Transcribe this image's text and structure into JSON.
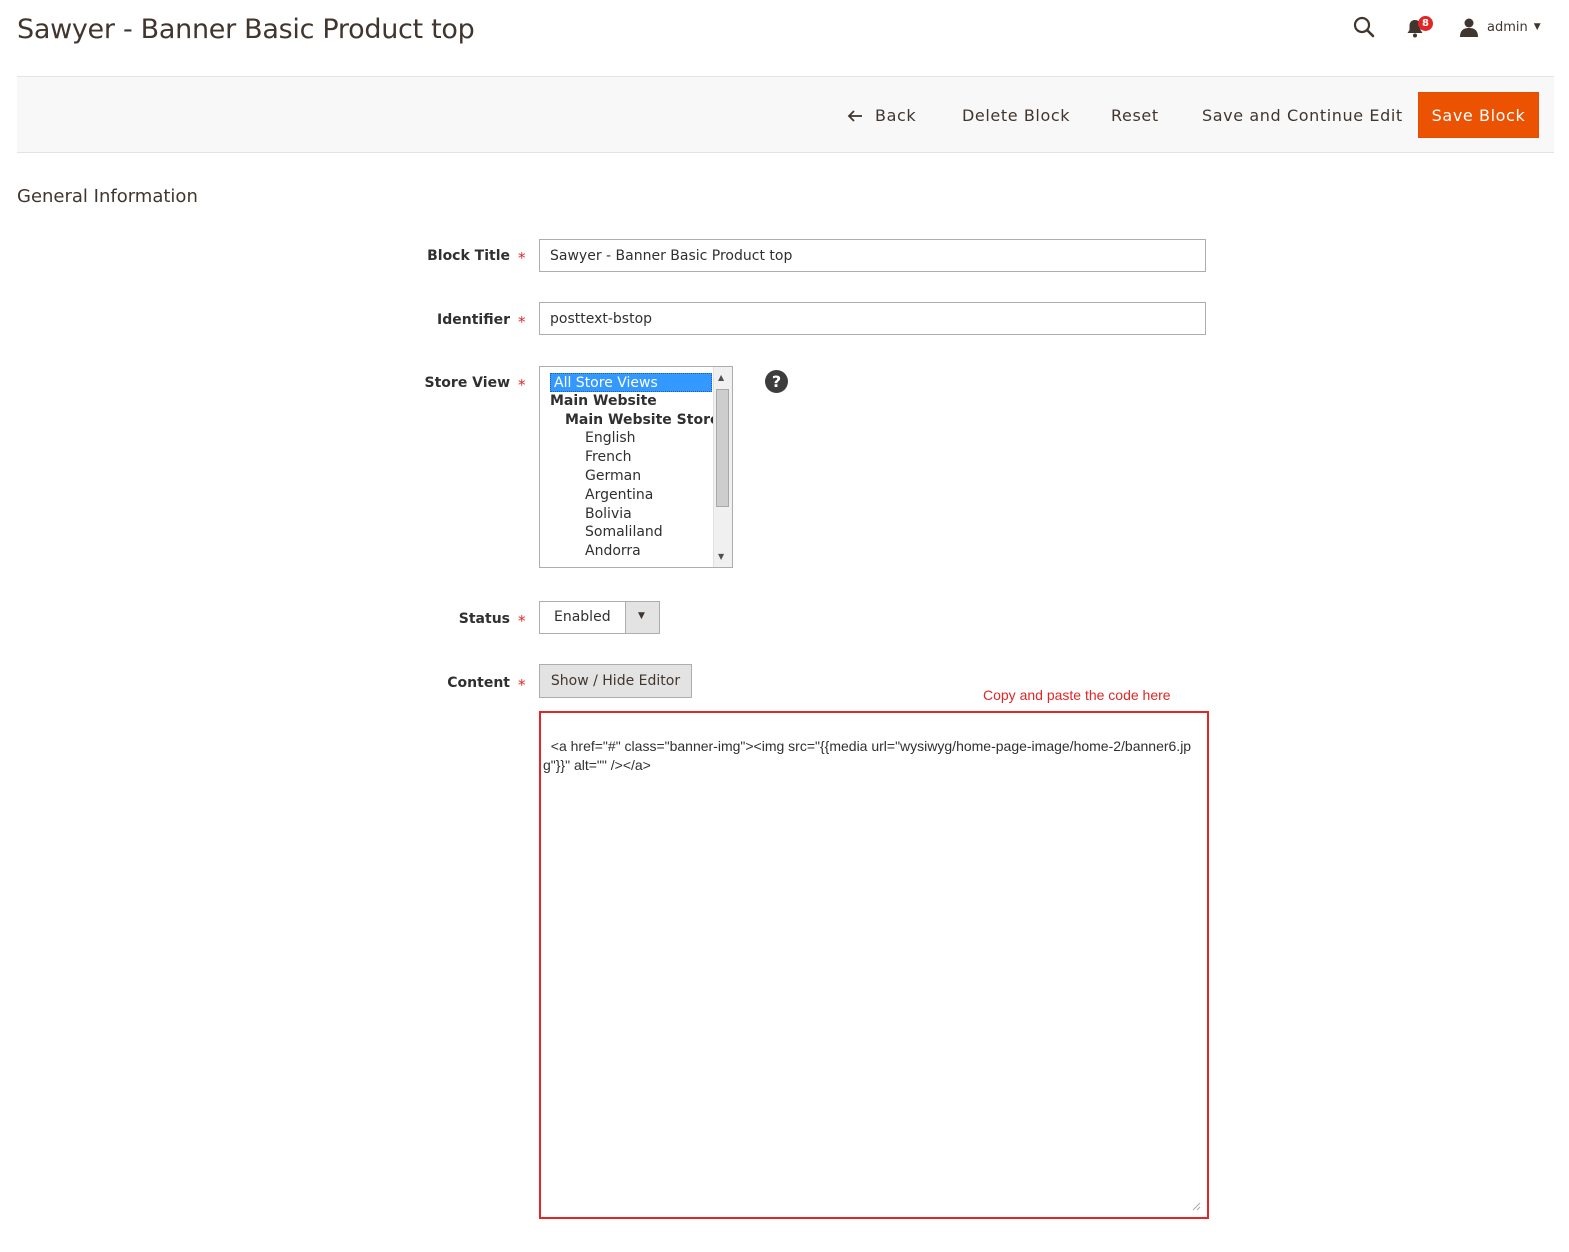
{
  "page": {
    "title": "Sawyer - Banner Basic Product top"
  },
  "header": {
    "notifications_count": "8",
    "user_name": "admin",
    "icons": {
      "search": "search-icon",
      "notifications": "bell-icon",
      "user": "user-icon",
      "caret": "caret-down-icon"
    }
  },
  "toolbar": {
    "back_label": "Back",
    "delete_label": "Delete Block",
    "reset_label": "Reset",
    "save_continue_label": "Save and Continue Edit",
    "save_label": "Save Block",
    "accent_color": "#eb5202"
  },
  "section": {
    "title": "General Information"
  },
  "form": {
    "block_title": {
      "label": "Block Title",
      "value": "Sawyer - Banner Basic Product top"
    },
    "identifier": {
      "label": "Identifier",
      "value": "posttext-bstop"
    },
    "store_view": {
      "label": "Store View",
      "options": [
        {
          "label": "All Store Views",
          "level": "selected"
        },
        {
          "label": "Main Website",
          "level": "group1"
        },
        {
          "label": "Main Website Store",
          "level": "group2"
        },
        {
          "label": "English",
          "level": "leaf"
        },
        {
          "label": "French",
          "level": "leaf"
        },
        {
          "label": "German",
          "level": "leaf"
        },
        {
          "label": "Argentina",
          "level": "leaf"
        },
        {
          "label": "Bolivia",
          "level": "leaf"
        },
        {
          "label": "Somaliland",
          "level": "leaf"
        },
        {
          "label": "Andorra",
          "level": "leaf"
        }
      ]
    },
    "status": {
      "label": "Status",
      "value": "Enabled"
    },
    "content": {
      "label": "Content",
      "editor_button": "Show / Hide Editor",
      "annotation": "Copy and paste the code here",
      "value": "<a href=\"#\" class=\"banner-img\"><img src=\"{{media url=\"wysiwyg/home-page-image/home-2/banner6.jpg\"}}\" alt=\"\" /></a>"
    },
    "required_mark": "*"
  }
}
